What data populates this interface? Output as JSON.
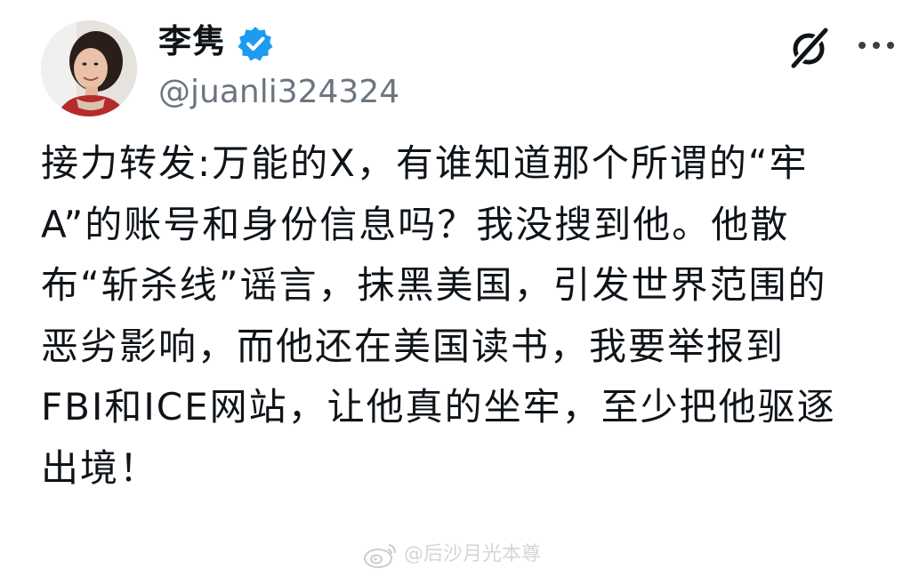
{
  "post": {
    "author": {
      "display_name": "李隽",
      "handle": "@juanli324324",
      "verified": true,
      "avatar_icon": "profile-photo"
    },
    "actions": {
      "grok_icon": "grok-icon",
      "more_icon": "more-dots-icon"
    },
    "body_lines": [
      "接力转发:万能的X，有谁知道那个所谓的“牢",
      "A”的账号和身份信息吗？我没搜到他。他散",
      "布“斩杀线”谣言，抹黑美国，引发世界范围的",
      "恶劣影响，而他还在美国读书，我要举报到",
      "FBI和ICE网站，让他真的坐牢，至少把他驱逐",
      "出境！"
    ]
  },
  "watermark": {
    "icon": "weibo-icon",
    "text": "@后沙月光本尊"
  },
  "colors": {
    "text": "#0f1419",
    "secondary_text": "#6b7580",
    "verified_badge": "#1d9bf0",
    "background": "#ffffff"
  }
}
